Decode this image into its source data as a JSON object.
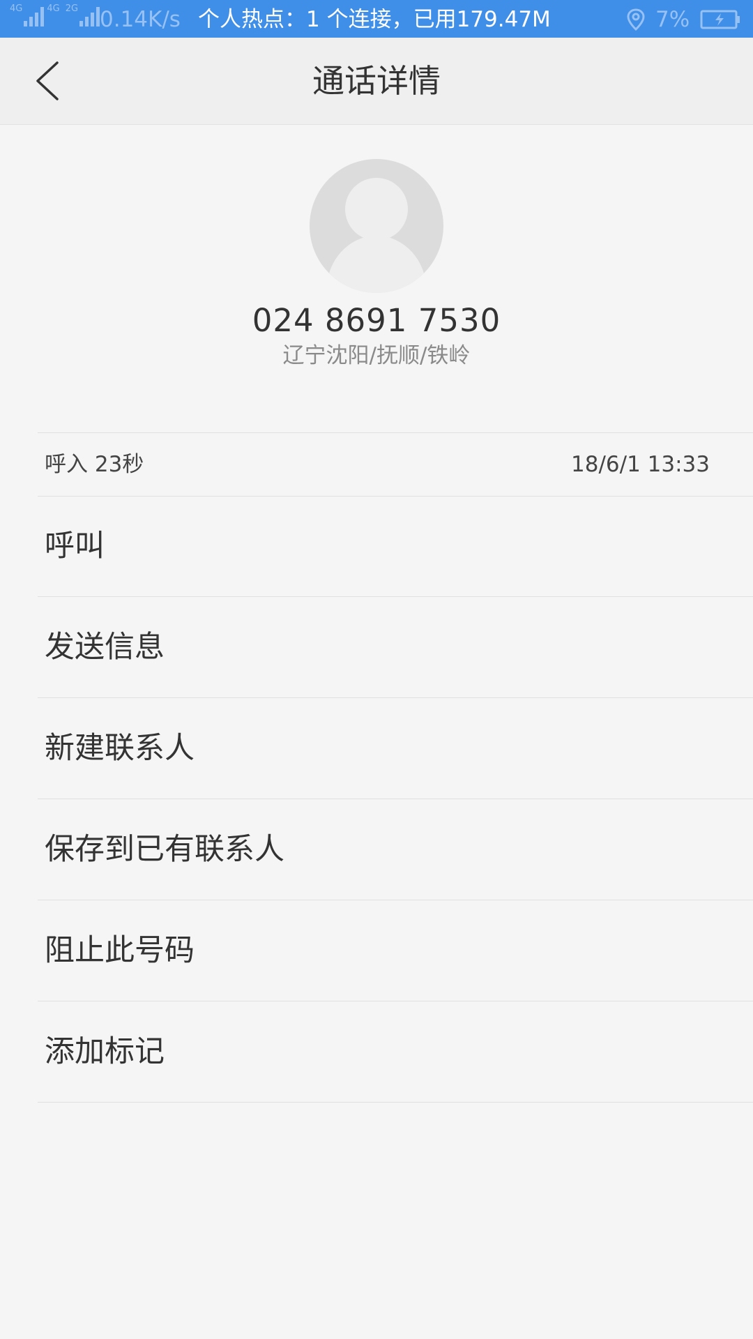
{
  "status_bar": {
    "network_1": "4G",
    "network_2": "4G",
    "network_3": "2G",
    "speed": "0.14K/s",
    "hotspot": "个人热点：1 个连接，已用179.47M",
    "battery": "7%"
  },
  "header": {
    "back_icon": "chevron-left-icon",
    "title": "通话详情"
  },
  "contact": {
    "avatar_icon": "default-avatar-icon",
    "number": "024 8691 7530",
    "location": "辽宁沈阳/抚顺/铁岭"
  },
  "call_record": {
    "type_duration": "呼入  23秒",
    "datetime": "18/6/1 13:33"
  },
  "actions": [
    {
      "label": "呼叫"
    },
    {
      "label": "发送信息"
    },
    {
      "label": "新建联系人"
    },
    {
      "label": "保存到已有联系人"
    },
    {
      "label": "阻止此号码"
    },
    {
      "label": "添加标记"
    }
  ],
  "colors": {
    "status_bar": "#3f8ee8",
    "header": "#efefef",
    "background": "#f5f5f5",
    "text_primary": "#333333",
    "text_secondary": "#8a8a8a",
    "divider": "#e0e0e0"
  }
}
